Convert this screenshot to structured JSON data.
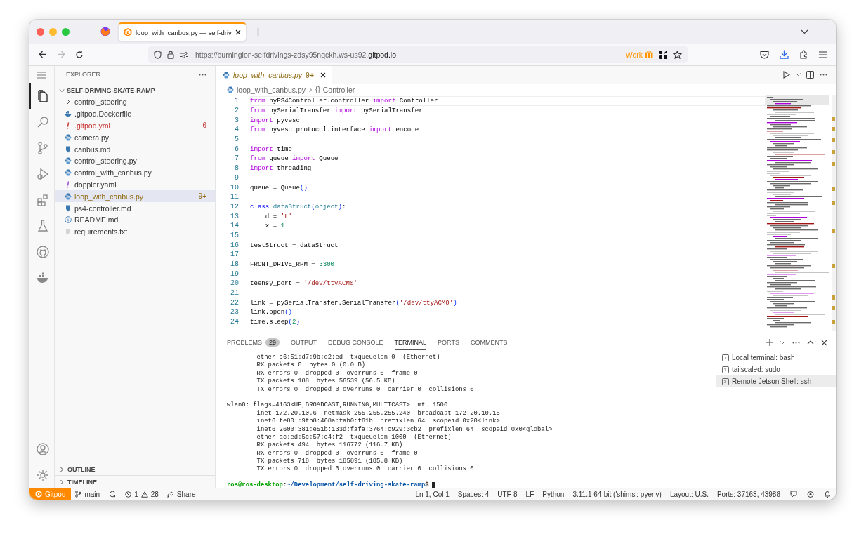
{
  "browser": {
    "tab_title": "loop_with_canbus.py — self-driv",
    "url_dim": "https://burningion-selfdrivings-zdsy95nqckh.ws-us92.",
    "url_host": "gitpod.io",
    "container": "Work",
    "forward_disabled": true
  },
  "activity_bar": [
    {
      "selected": true
    },
    {
      "selected": false
    },
    {
      "selected": false
    },
    {
      "selected": false
    },
    {
      "selected": false
    },
    {
      "selected": false
    },
    {
      "selected": false
    },
    {
      "selected": false
    }
  ],
  "sidebar": {
    "title": "EXPLORER",
    "root": {
      "label": "SELF-DRIVING-SKATE-RAMP",
      "expanded": true
    },
    "items": [
      {
        "name": "control_steering",
        "kind": "folder",
        "error": false,
        "warning": false,
        "selected": false
      },
      {
        "name": ".gitpod.Dockerfile",
        "kind": "docker",
        "error": false,
        "warning": false,
        "selected": false
      },
      {
        "name": ".gitpod.yml",
        "kind": "yaml",
        "error": true,
        "warning": false,
        "badge": "6",
        "selected": false
      },
      {
        "name": "camera.py",
        "kind": "python",
        "error": false,
        "warning": false,
        "selected": false
      },
      {
        "name": "canbus.md",
        "kind": "markdown",
        "error": false,
        "warning": false,
        "selected": false
      },
      {
        "name": "control_steering.py",
        "kind": "python",
        "error": false,
        "warning": false,
        "selected": false
      },
      {
        "name": "control_with_canbus.py",
        "kind": "python",
        "error": false,
        "warning": false,
        "selected": false
      },
      {
        "name": "doppler.yaml",
        "kind": "yaml",
        "error": false,
        "warning": false,
        "selected": false
      },
      {
        "name": "loop_with_canbus.py",
        "kind": "python",
        "error": false,
        "warning": true,
        "badge": "9+",
        "selected": true
      },
      {
        "name": "ps4-controller.md",
        "kind": "markdown",
        "error": false,
        "warning": false,
        "selected": false
      },
      {
        "name": "README.md",
        "kind": "info",
        "error": false,
        "warning": false,
        "selected": false
      },
      {
        "name": "requirements.txt",
        "kind": "text",
        "error": false,
        "warning": false,
        "selected": false
      }
    ],
    "sections": [
      {
        "label": "OUTLINE",
        "expanded": false
      },
      {
        "label": "TIMELINE",
        "expanded": false
      }
    ]
  },
  "editor": {
    "tab": {
      "label": "loop_with_canbus.py",
      "badge": "9+"
    },
    "breadcrumbs": [
      {
        "label": "loop_with_canbus.py",
        "kind": "file"
      },
      {
        "glyph": "{}",
        "label": "Controller",
        "kind": "symbol"
      }
    ],
    "lines": [
      {
        "number": "1",
        "current": true,
        "tokens": [
          {
            "text": "from",
            "kind": "kw"
          },
          {
            "text": " pyPS4Controller.controller ",
            "kind": "p"
          },
          {
            "text": "import",
            "kind": "kw"
          },
          {
            "text": " Controller",
            "kind": "p"
          }
        ]
      },
      {
        "number": "2",
        "current": false,
        "tokens": [
          {
            "text": "from",
            "kind": "kw"
          },
          {
            "text": " pySerialTransfer ",
            "kind": "p"
          },
          {
            "text": "import",
            "kind": "kw"
          },
          {
            "text": " pySerialTransfer",
            "kind": "p"
          }
        ]
      },
      {
        "number": "3",
        "current": false,
        "tokens": [
          {
            "text": "import",
            "kind": "kw"
          },
          {
            "text": " pyvesc",
            "kind": "p"
          }
        ]
      },
      {
        "number": "4",
        "current": false,
        "tokens": [
          {
            "text": "from",
            "kind": "kw"
          },
          {
            "text": " pyvesc.protocol.interface ",
            "kind": "p"
          },
          {
            "text": "import",
            "kind": "kw"
          },
          {
            "text": " encode",
            "kind": "p"
          }
        ]
      },
      {
        "number": "5",
        "current": false
      },
      {
        "number": "6",
        "current": false,
        "tokens": [
          {
            "text": "import",
            "kind": "kw"
          },
          {
            "text": " time",
            "kind": "p"
          }
        ]
      },
      {
        "number": "7",
        "current": false,
        "tokens": [
          {
            "text": "from",
            "kind": "kw"
          },
          {
            "text": " queue ",
            "kind": "p"
          },
          {
            "text": "import",
            "kind": "kw"
          },
          {
            "text": " Queue",
            "kind": "p"
          }
        ]
      },
      {
        "number": "8",
        "current": false,
        "tokens": [
          {
            "text": "import",
            "kind": "kw"
          },
          {
            "text": " threading",
            "kind": "p"
          }
        ]
      },
      {
        "number": "9",
        "current": false
      },
      {
        "number": "10",
        "current": false,
        "tokens": [
          {
            "text": "queue = Queue",
            "kind": "p"
          },
          {
            "text": "()",
            "kind": "br"
          }
        ]
      },
      {
        "number": "11",
        "current": false
      },
      {
        "number": "12",
        "current": false,
        "tokens": [
          {
            "text": "class",
            "kind": "decl"
          },
          {
            "text": " dataStruct",
            "kind": "type"
          },
          {
            "text": "(",
            "kind": "br"
          },
          {
            "text": "object",
            "kind": "type"
          },
          {
            "text": ")",
            "kind": "br"
          },
          {
            "text": ":",
            "kind": "p"
          }
        ]
      },
      {
        "number": "13",
        "current": false,
        "tokens": [
          {
            "text": "    d = ",
            "kind": "p"
          },
          {
            "text": "'L'",
            "kind": "str"
          }
        ]
      },
      {
        "number": "14",
        "current": false,
        "tokens": [
          {
            "text": "    x = ",
            "kind": "p"
          },
          {
            "text": "1",
            "kind": "num"
          }
        ]
      },
      {
        "number": "15",
        "current": false
      },
      {
        "number": "16",
        "current": false,
        "tokens": [
          {
            "text": "testStruct = dataStruct",
            "kind": "p"
          }
        ]
      },
      {
        "number": "17",
        "current": false
      },
      {
        "number": "18",
        "current": false,
        "tokens": [
          {
            "text": "FRONT_DRIVE_RPM = ",
            "kind": "p"
          },
          {
            "text": "3300",
            "kind": "num"
          }
        ]
      },
      {
        "number": "19",
        "current": false
      },
      {
        "number": "20",
        "current": false,
        "tokens": [
          {
            "text": "teensy_port = ",
            "kind": "p"
          },
          {
            "text": "'/dev/ttyACM0'",
            "kind": "str"
          }
        ]
      },
      {
        "number": "21",
        "current": false
      },
      {
        "number": "22",
        "current": false,
        "tokens": [
          {
            "text": "link = pySerialTransfer.SerialTransfer",
            "kind": "p"
          },
          {
            "text": "(",
            "kind": "br"
          },
          {
            "text": "'/dev/ttyACM0'",
            "kind": "str"
          },
          {
            "text": ")",
            "kind": "br"
          }
        ]
      },
      {
        "number": "23",
        "current": false,
        "tokens": [
          {
            "text": "link.open",
            "kind": "p"
          },
          {
            "text": "()",
            "kind": "br"
          }
        ]
      },
      {
        "number": "24",
        "current": false,
        "tokens": [
          {
            "text": "time.sleep",
            "kind": "p"
          },
          {
            "text": "(",
            "kind": "br"
          },
          {
            "text": "2",
            "kind": "num"
          },
          {
            "text": ")",
            "kind": "br"
          }
        ]
      }
    ]
  },
  "panel": {
    "tabs": [
      {
        "label": "PROBLEMS",
        "badge": "29",
        "selected": false
      },
      {
        "label": "OUTPUT",
        "selected": false
      },
      {
        "label": "DEBUG CONSOLE",
        "selected": false
      },
      {
        "label": "TERMINAL",
        "selected": true
      },
      {
        "label": "PORTS",
        "selected": false
      },
      {
        "label": "COMMENTS",
        "selected": false
      }
    ],
    "output_blocks": [
      [
        "        ether c6:51:d7:9b:e2:ed  txqueuelen 0  (Ethernet)",
        "        RX packets 0  bytes 0 (0.0 B)",
        "        RX errors 0  dropped 0  overruns 0  frame 0",
        "        TX packets 188  bytes 56539 (56.5 KB)",
        "        TX errors 0  dropped 0 overruns 0  carrier 0  collisions 0"
      ],
      [
        "wlan0: flags=4163<UP,BROADCAST,RUNNING,MULTICAST>  mtu 1500",
        "        inet 172.20.10.6  netmask 255.255.255.240  broadcast 172.20.10.15",
        "        inet6 fe80::9fb8:468a:fab0:f61b  prefixlen 64  scopeid 0x20<link>",
        "        inet6 2600:381:e51b:133d:fafa:3764:c929:3cb2  prefixlen 64  scopeid 0x0<global>",
        "        ether ac:ed:5c:57:c4:f2  txqueuelen 1000  (Ethernet)",
        "        RX packets 494  bytes 116772 (116.7 KB)",
        "        RX errors 0  dropped 0  overruns 0  frame 0",
        "        TX packets 718  bytes 185891 (185.8 KB)",
        "        TX errors 0  dropped 0 overruns 0  carrier 0  collisions 0"
      ]
    ],
    "prompt": [
      {
        "text": "ros@ros-desktop",
        "kind": "host"
      },
      {
        "text": ":",
        "kind": "p"
      },
      {
        "text": "~/Development/self-driving-skate-ramp",
        "kind": "path"
      },
      {
        "text": "$",
        "kind": "p"
      }
    ],
    "terminals": [
      {
        "label": "Local terminal: bash",
        "selected": false
      },
      {
        "label": "tailscaled: sudo",
        "selected": false
      },
      {
        "label": "Remote Jetson Shell: ssh",
        "selected": true
      }
    ]
  },
  "status_bar": {
    "left": [
      {
        "kind": "remote",
        "label": "Gitpod"
      },
      {
        "kind": "branch",
        "label": "main"
      },
      {
        "kind": "sync"
      },
      {
        "kind": "problems",
        "errors": "1",
        "warnings": "28"
      },
      {
        "kind": "share",
        "label": "Share"
      }
    ],
    "right": [
      {
        "kind": "text",
        "label": "Ln 1, Col 1"
      },
      {
        "kind": "text",
        "label": "Spaces: 4"
      },
      {
        "kind": "text",
        "label": "UTF-8"
      },
      {
        "kind": "text",
        "label": "LF"
      },
      {
        "kind": "text",
        "label": "Python"
      },
      {
        "kind": "text",
        "label": "3.11.1 64-bit ('shims': pyenv)"
      },
      {
        "kind": "text",
        "label": "Layout: U.S."
      },
      {
        "kind": "text",
        "label": "Ports: 37163, 43988"
      },
      {
        "kind": "feedback"
      },
      {
        "kind": "copilot"
      },
      {
        "kind": "bell"
      }
    ]
  }
}
